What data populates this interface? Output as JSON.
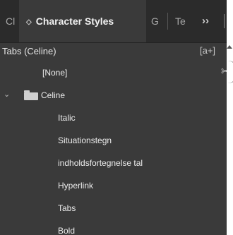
{
  "tabs": [
    {
      "label": "Cl",
      "active": false
    },
    {
      "label": "Character Styles",
      "active": true
    },
    {
      "label": "G",
      "active": false
    },
    {
      "label": "Te",
      "active": false
    }
  ],
  "overflow_label": "››",
  "header": {
    "title": "Tabs (Celine)",
    "new_group_icon": "[a+]"
  },
  "none_label": "[None]",
  "group": {
    "name": "Celine",
    "expanded": true
  },
  "styles": [
    "Italic",
    "Situationstegn",
    "indholdsfortegnelse tal",
    "Hyperlink",
    "Tabs",
    "Bold"
  ],
  "colors": {
    "panel": "#3a3a3a",
    "tabbar": "#2b2b2b",
    "text": "#ececec"
  }
}
